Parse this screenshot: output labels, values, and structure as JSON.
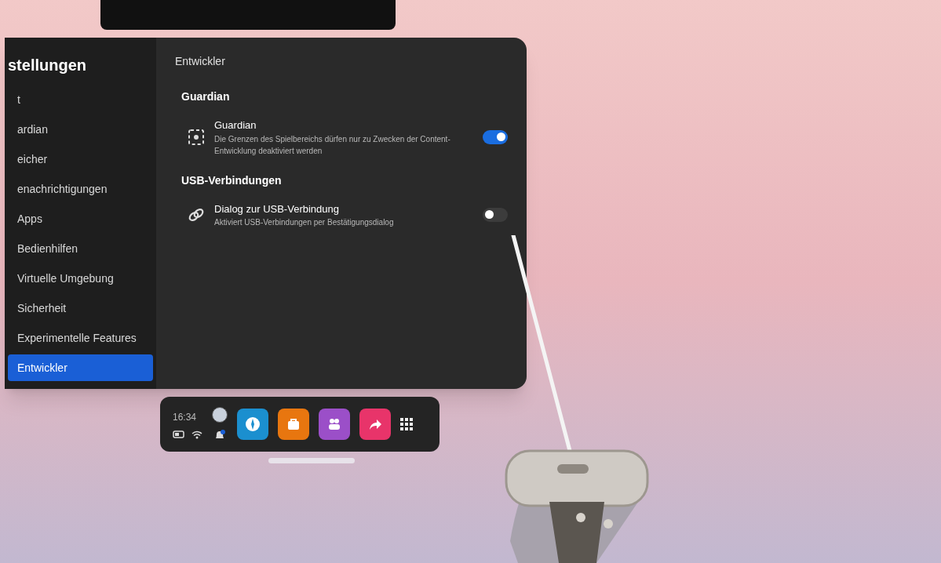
{
  "settings_panel": {
    "title": "stellungen",
    "sidebar": {
      "items": [
        {
          "label": "t",
          "selected": false
        },
        {
          "label": "ardian",
          "selected": false
        },
        {
          "label": "eicher",
          "selected": false
        },
        {
          "label": "enachrichtigungen",
          "selected": false
        },
        {
          "label": "Apps",
          "selected": false
        },
        {
          "label": "Bedienhilfen",
          "selected": false
        },
        {
          "label": "Virtuelle Umgebung",
          "selected": false
        },
        {
          "label": "Sicherheit",
          "selected": false
        },
        {
          "label": "Experimentelle Features",
          "selected": false
        },
        {
          "label": "Entwickler",
          "selected": true
        }
      ]
    },
    "content": {
      "heading": "Entwickler",
      "sections": [
        {
          "title": "Guardian",
          "items": [
            {
              "kind": "boundary",
              "title": "Guardian",
              "description": "Die Grenzen des Spielbereichs dürfen nur zu Zwecken der Content-Entwicklung deaktiviert werden",
              "on": true
            }
          ]
        },
        {
          "title": "USB-Verbindungen",
          "items": [
            {
              "kind": "link",
              "title": "Dialog zur USB-Verbindung",
              "description": "Aktiviert USB-Verbindungen per Bestätigungsdialog",
              "on": false
            }
          ]
        }
      ]
    }
  },
  "taskbar": {
    "time": "16:34",
    "apps": [
      {
        "kind": "explore",
        "color": "#1b8fcf"
      },
      {
        "kind": "store",
        "color": "#e8760f"
      },
      {
        "kind": "people",
        "color": "#9b4fc8"
      },
      {
        "kind": "share",
        "color": "#e8346a"
      }
    ]
  }
}
